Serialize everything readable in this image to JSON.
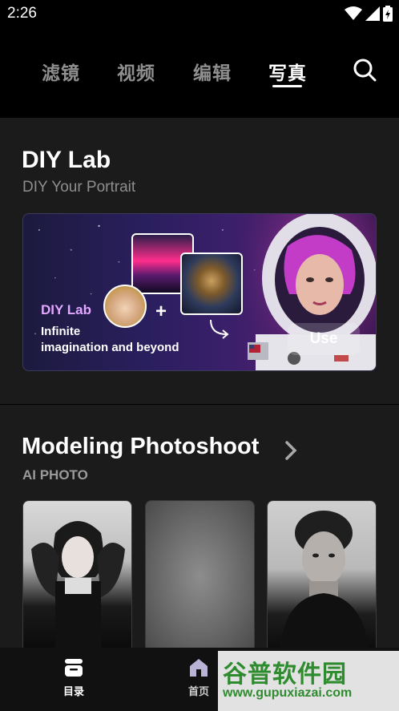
{
  "status_bar": {
    "time": "2:26",
    "icons": [
      "wifi-icon",
      "signal-icon",
      "battery-charging-icon"
    ]
  },
  "top_nav": {
    "tabs": [
      {
        "label": "滤镜",
        "active": false
      },
      {
        "label": "视频",
        "active": false
      },
      {
        "label": "编辑",
        "active": false
      },
      {
        "label": "写真",
        "active": true
      }
    ],
    "search_icon": "search-icon"
  },
  "diy_lab": {
    "title": "DIY Lab",
    "subtitle": "DIY Your Portrait",
    "banner": {
      "label": "DIY Lab",
      "line1": "Infinite",
      "line2": "imagination and beyond",
      "plus": "+",
      "use_button": "Use"
    }
  },
  "modeling": {
    "title": "Modeling Photoshoot",
    "subtitle": "AI PHOTO",
    "chevron_icon": "chevron-right-icon",
    "photos": [
      "portrait-woman-bw",
      "portrait-blurred",
      "portrait-man-bw"
    ]
  },
  "bottom_nav": {
    "items": [
      {
        "label": "目录",
        "icon": "catalog-icon",
        "active": true
      },
      {
        "label": "首页",
        "icon": "home-icon",
        "active": false
      }
    ]
  },
  "watermark": {
    "top": "谷普软件园",
    "bottom": "www.gupuxiazai.com"
  },
  "colors": {
    "background": "#000000",
    "section": "#1b1b1b",
    "accent_purple": "#e2a8ff",
    "inactive_tab": "#8f8f8f"
  }
}
